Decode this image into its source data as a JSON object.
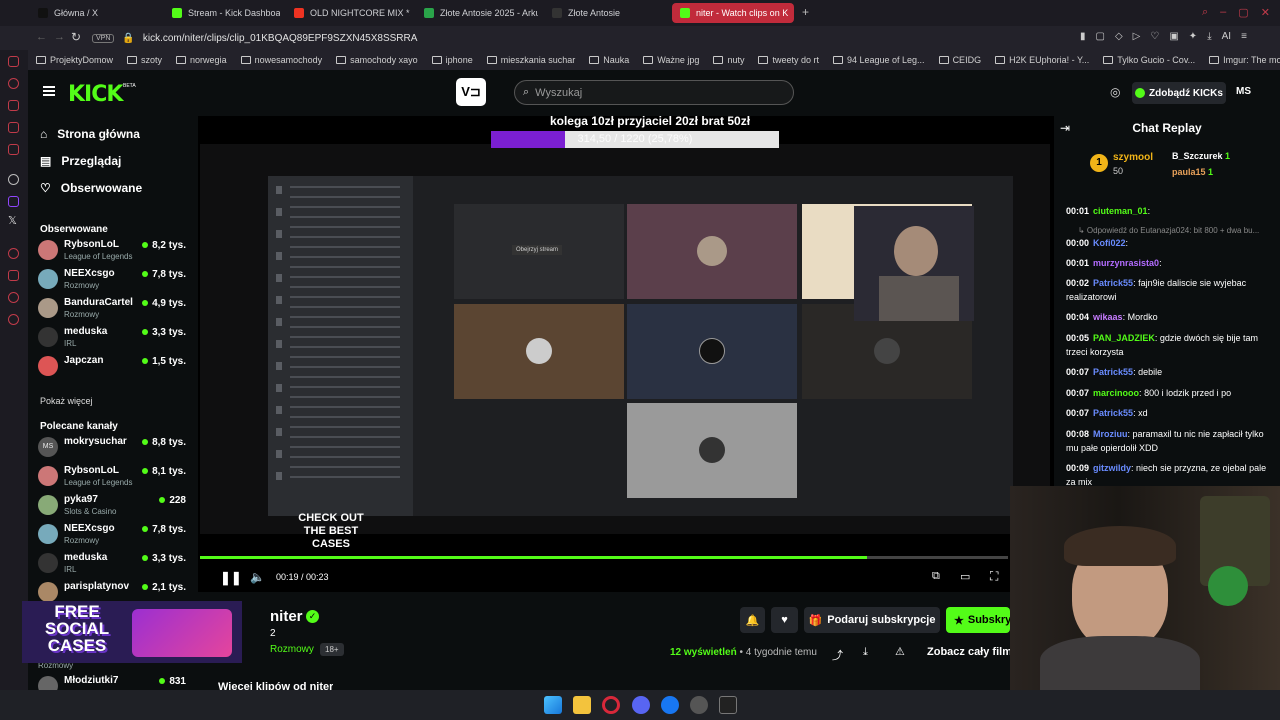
{
  "browser": {
    "tabs": [
      {
        "title": "Główna / X",
        "color": "#111111"
      },
      {
        "title": "Stream - Kick Dashboard",
        "color": "#53fc18"
      },
      {
        "title": "OLD NIGHTCORE MIX *20",
        "color": "#e32"
      },
      {
        "title": "Złote Antosie 2025 - Arku",
        "color": "#2aa44a"
      },
      {
        "title": "Złote Antosie",
        "color": "#333"
      },
      {
        "title": "niter - Watch clips on K",
        "color": "#53fc18",
        "active": true
      }
    ],
    "url": "kick.com/niter/clips/clip_01KBQAQ89EPF9SZXN45X8SSRRA",
    "vpn": "VPN",
    "ai_label": "AI",
    "bookmarks": [
      "ProjektyDomow",
      "szoty",
      "norwegia",
      "nowesamochody",
      "samochody xayo",
      "iphone",
      "mieszkania suchar",
      "Nauka",
      "Ważne jpg",
      "nuty",
      "tweety do rt",
      "94 League of Leg...",
      "CEIDG",
      "H2K EUphoria! - Y...",
      "Tylko Gucio - Cov...",
      "Imgur: The most a..."
    ]
  },
  "header": {
    "logo": "KICK",
    "logo_beta": "BETA",
    "search_placeholder": "Wyszukaj",
    "get_kicks": "Zdobądź KICKs",
    "avatar_initials": "MS"
  },
  "sidebar": {
    "nav": [
      "Strona główna",
      "Przeglądaj",
      "Obserwowane"
    ],
    "followed_title": "Obserwowane",
    "followed": [
      {
        "name": "RybsonLoL",
        "category": "League of Legends",
        "viewers": "8,2 tys.",
        "color": "#c77"
      },
      {
        "name": "NEEXcsgo",
        "category": "Rozmowy",
        "viewers": "7,8 tys.",
        "color": "#7ab"
      },
      {
        "name": "BanduraCartel",
        "category": "Rozmowy",
        "viewers": "4,9 tys.",
        "color": "#a98"
      },
      {
        "name": "meduska",
        "category": "IRL",
        "viewers": "3,3 tys.",
        "color": "#333"
      },
      {
        "name": "Japczan",
        "category": "",
        "viewers": "1,5 tys.",
        "color": "#d55"
      }
    ],
    "show_more": "Pokaż więcej",
    "recommended_title": "Polecane kanały",
    "recommended": [
      {
        "name": "mokrysuchar",
        "category": "",
        "viewers": "8,8 tys.",
        "color": "#555",
        "initials": "MS"
      },
      {
        "name": "RybsonLoL",
        "category": "League of Legends",
        "viewers": "8,1 tys.",
        "color": "#c77"
      },
      {
        "name": "pyka97",
        "category": "Slots & Casino",
        "viewers": "228",
        "color": "#8a7"
      },
      {
        "name": "NEEXcsgo",
        "category": "Rozmowy",
        "viewers": "7,8 tys.",
        "color": "#7ab"
      },
      {
        "name": "meduska",
        "category": "IRL",
        "viewers": "3,3 tys.",
        "color": "#333"
      },
      {
        "name": "parisplatynov",
        "category": "",
        "viewers": "2,1 tys.",
        "color": "#a86"
      }
    ],
    "bottom_channel": {
      "name": "Młodziutki7",
      "viewers": "831",
      "category": "Rozmowy"
    }
  },
  "video": {
    "caption": "kolega 10zł przyjaciel 20zł brat 50zł",
    "goal_text": "314,50 / 1220 (25,78%)",
    "goal_fraction": 0.2578,
    "time": "00:19 / 00:23",
    "progress_fraction": 0.826,
    "inner_tile_label": "Obejrzyj stream",
    "promo": "CHECK OUT THE BEST CASES",
    "ad_text": "FREE SOCIAL CASES"
  },
  "clipinfo": {
    "channel": "niter",
    "count": "2",
    "category": "Rozmowy",
    "age_badge": "18+",
    "views_count": "12",
    "views_label": "wyświetleń",
    "time_ago": "• 4 tygodnie temu",
    "subscribe_gift": "Podaruj subskrypcje",
    "subscribe": "Subskry",
    "full_film": "Zobacz cały film",
    "more_clips": "Więcej klipów od niter"
  },
  "chat": {
    "title": "Chat Replay",
    "top": [
      {
        "rank": "1",
        "name": "szymool",
        "value": "50"
      },
      {
        "name": "B_Szczurek",
        "value": "1"
      },
      {
        "name": "paula15",
        "value": "1"
      }
    ],
    "messages": [
      {
        "t": "00:01",
        "user": "ciuteman_01",
        "color": "#53fc18",
        "text": ""
      },
      {
        "t": "",
        "user": "",
        "color": "#999",
        "text": "↳ Odpowiedź do Eutanazja024: bit 800 + dwa bu..."
      },
      {
        "t": "00:00",
        "user": "Kofi022",
        "color": "#6a8cff",
        "text": ""
      },
      {
        "t": "00:01",
        "user": "murzynrasista0",
        "color": "#b36cff",
        "text": ""
      },
      {
        "t": "00:02",
        "user": "Patrick55",
        "color": "#6a8cff",
        "text": "fajn9ie daliscie sie wyjebac realizatorowi"
      },
      {
        "t": "00:04",
        "user": "wikaas",
        "color": "#c77cff",
        "text": "Mordko"
      },
      {
        "t": "00:05",
        "user": "PAN_JADZIEK",
        "color": "#53fc18",
        "text": "gdzie dwóch się bije tam trzeci korzysta"
      },
      {
        "t": "00:07",
        "user": "Patrick55",
        "color": "#6a8cff",
        "text": "debile"
      },
      {
        "t": "00:07",
        "user": "marcinooo",
        "color": "#53fc18",
        "text": "800 i lodzik przed i po"
      },
      {
        "t": "00:07",
        "user": "Patrick55",
        "color": "#6a8cff",
        "text": "xd"
      },
      {
        "t": "00:08",
        "user": "Mroziuu",
        "color": "#6a8cff",
        "text": "paramaxil tu nic nie zapłacił tylko mu pałe opierdolił XDD"
      },
      {
        "t": "00:09",
        "user": "gitzwildy",
        "color": "#6a8cff",
        "text": "niech sie przyzna, ze ojebal pale za mix"
      }
    ]
  }
}
